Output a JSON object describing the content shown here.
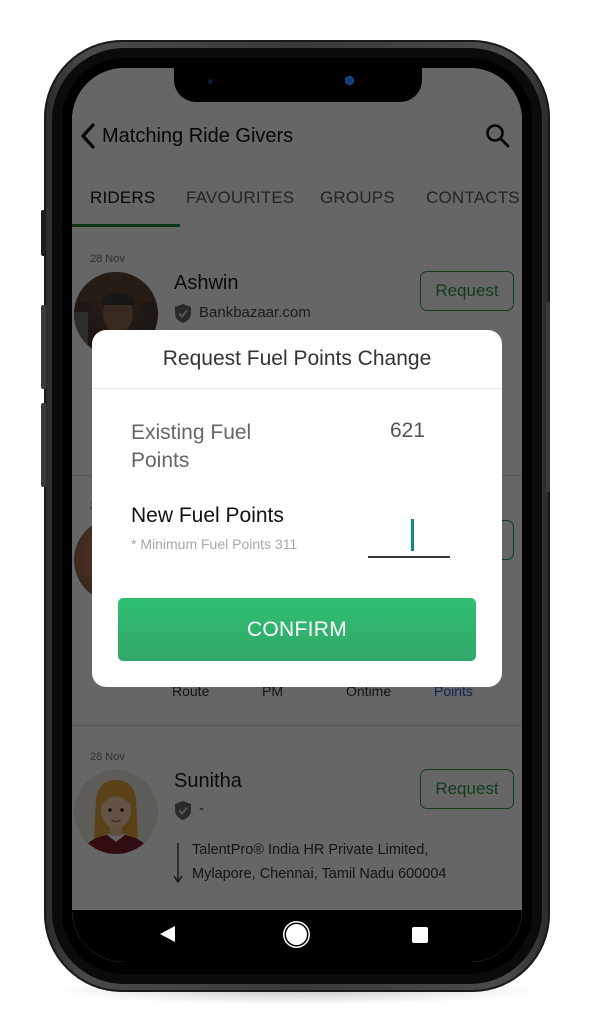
{
  "header": {
    "title": "Matching Ride Givers",
    "back_icon": "chevron-left-icon",
    "search_icon": "search-icon"
  },
  "tabs": [
    {
      "label": "RIDERS",
      "active": true
    },
    {
      "label": "FAVOURITES",
      "active": false
    },
    {
      "label": "GROUPS",
      "active": false
    },
    {
      "label": "CONTACTS",
      "active": false
    }
  ],
  "riders": [
    {
      "date": "28 Nov",
      "name": "Ashwin",
      "company": "Bankbazaar.com",
      "request_label": "Request"
    },
    {
      "date": "28 Nov",
      "request_label": "Request",
      "stats": [
        "Route",
        "PM",
        "Ontime",
        "Points"
      ]
    },
    {
      "date": "28 Nov",
      "name": "Sunitha",
      "company": "-",
      "request_label": "Request",
      "address_line1": "TalentPro® India HR Private Limited,",
      "address_line2": "Mylapore, Chennai, Tamil Nadu 600004"
    }
  ],
  "dialog": {
    "title": "Request Fuel Points Change",
    "existing_label": "Existing Fuel Points",
    "existing_value": "621",
    "new_label": "New Fuel Points",
    "minimum_note": "* Minimum Fuel Points 311",
    "new_value": "",
    "confirm_label": "CONFIRM"
  },
  "colors": {
    "accent_green": "#2e9a45",
    "confirm_green": "#2ebf71",
    "caret_teal": "#108d7d",
    "points_blue": "#2860c8"
  },
  "navbar": {
    "back": "nav-back-icon",
    "home": "nav-home-icon",
    "recents": "nav-recents-icon"
  }
}
